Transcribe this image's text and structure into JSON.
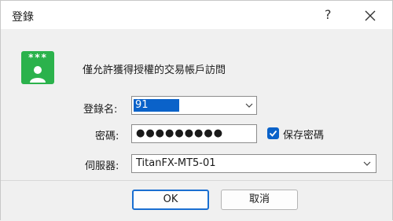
{
  "window": {
    "title": "登錄",
    "help_label": "?"
  },
  "logo": {
    "stars": "***"
  },
  "info_text": "僅允許獲得授權的交易帳戶訪問",
  "form": {
    "login_label": "登錄名:",
    "login_value": "91",
    "password_label": "密碼:",
    "password_value": "●●●●●●●●●",
    "save_password_label": "保存密碼",
    "save_password_checked": true,
    "server_label": "伺服器:",
    "server_value": "TitanFX-MT5-01"
  },
  "buttons": {
    "ok_label": "OK",
    "cancel_label": "取消"
  },
  "colors": {
    "accent": "#0a62c9",
    "logo_green": "#2bb24c"
  },
  "icons": {
    "close": "close-icon",
    "help": "help-icon",
    "chevron": "chevron-down-icon",
    "check": "check-icon",
    "user": "user-icon"
  }
}
